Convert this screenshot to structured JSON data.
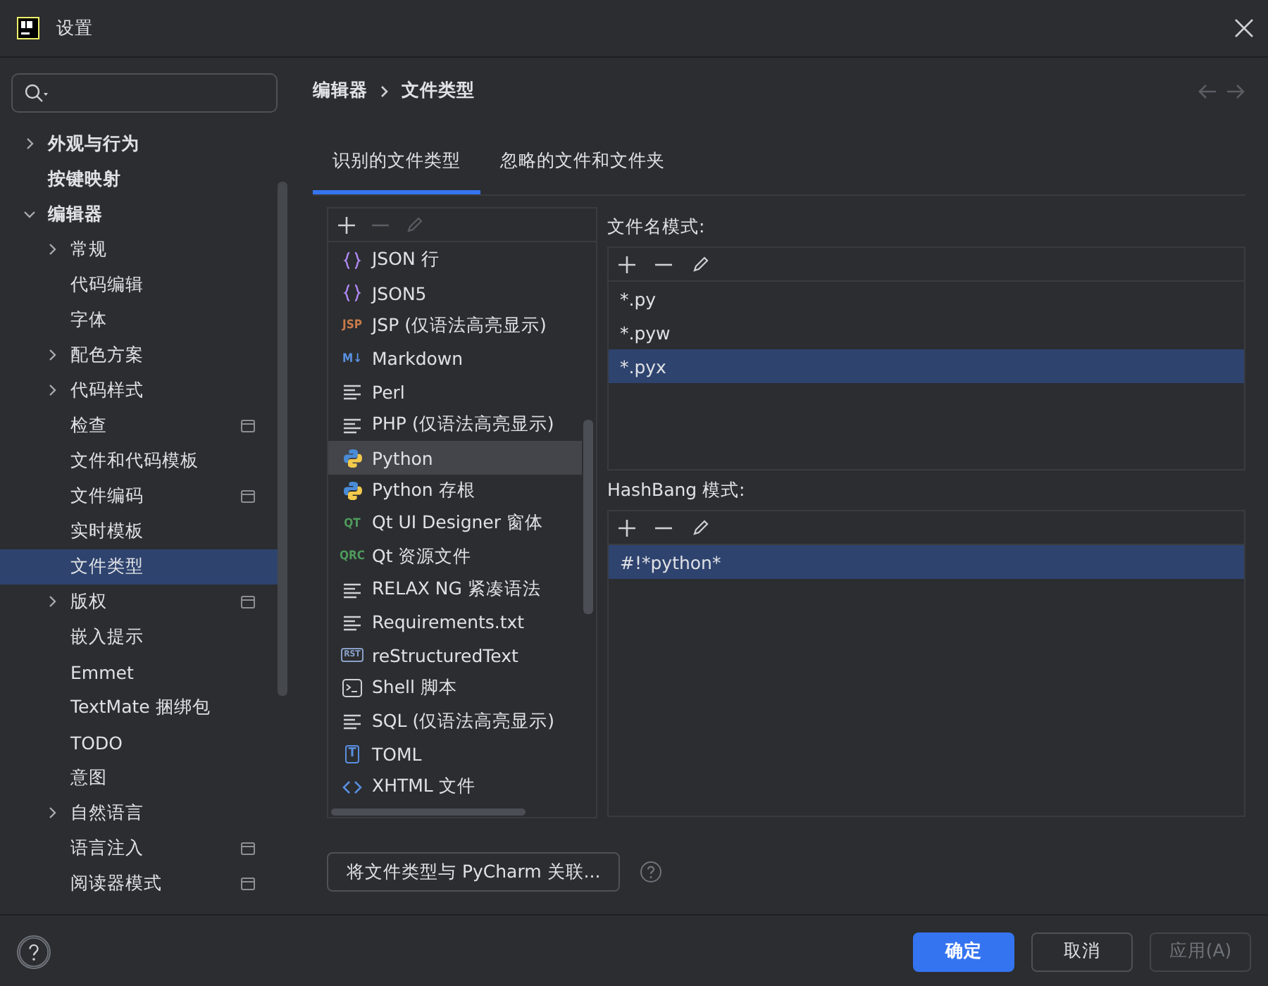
{
  "window": {
    "title": "设置"
  },
  "sidebar": {
    "items": [
      {
        "label": "外观与行为",
        "bold": true,
        "expanded": false,
        "selected": false,
        "project": false
      },
      {
        "label": "按键映射",
        "bold": true,
        "selected": false,
        "project": false
      },
      {
        "label": "编辑器",
        "bold": true,
        "expanded": true,
        "selected": false,
        "project": false,
        "children": [
          {
            "label": "常规",
            "expanded": false,
            "selected": false,
            "project": false
          },
          {
            "label": "代码编辑",
            "selected": false,
            "project": false
          },
          {
            "label": "字体",
            "selected": false,
            "project": false
          },
          {
            "label": "配色方案",
            "expanded": false,
            "selected": false,
            "project": false
          },
          {
            "label": "代码样式",
            "expanded": false,
            "selected": false,
            "project": false
          },
          {
            "label": "检查",
            "selected": false,
            "project": true
          },
          {
            "label": "文件和代码模板",
            "selected": false,
            "project": false
          },
          {
            "label": "文件编码",
            "selected": false,
            "project": true
          },
          {
            "label": "实时模板",
            "selected": false,
            "project": false
          },
          {
            "label": "文件类型",
            "selected": true,
            "project": false
          },
          {
            "label": "版权",
            "expanded": false,
            "selected": false,
            "project": true
          },
          {
            "label": "嵌入提示",
            "selected": false,
            "project": false
          },
          {
            "label": "Emmet",
            "selected": false,
            "project": false
          },
          {
            "label": "TextMate 捆绑包",
            "selected": false,
            "project": false
          },
          {
            "label": "TODO",
            "selected": false,
            "project": false
          },
          {
            "label": "意图",
            "selected": false,
            "project": false
          },
          {
            "label": "自然语言",
            "expanded": false,
            "selected": false,
            "project": false
          },
          {
            "label": "语言注入",
            "selected": false,
            "project": true
          },
          {
            "label": "阅读器模式",
            "selected": false,
            "project": true
          }
        ]
      }
    ]
  },
  "breadcrumb": [
    "编辑器",
    "文件类型"
  ],
  "tabs": [
    {
      "label": "识别的文件类型",
      "selected": true
    },
    {
      "label": "忽略的文件和文件夹",
      "selected": false
    }
  ],
  "file_types": {
    "toolbar": [
      {
        "kind": "add",
        "disabled": false
      },
      {
        "kind": "remove",
        "disabled": true
      },
      {
        "kind": "edit",
        "disabled": true
      }
    ],
    "items": [
      {
        "label": "JSON 行",
        "kind": "braces",
        "selected": false
      },
      {
        "label": "JSON5",
        "kind": "braces",
        "selected": false
      },
      {
        "label": "JSP (仅语法高亮显示)",
        "kind": "badge",
        "icon_text": "JSP",
        "color": "#c87a4a",
        "selected": false
      },
      {
        "label": "Markdown",
        "kind": "badge",
        "icon_text": "M↓",
        "color": "#5a8fe0",
        "selected": false
      },
      {
        "label": "Perl",
        "kind": "lines",
        "selected": false
      },
      {
        "label": "PHP (仅语法高亮显示)",
        "kind": "lines",
        "selected": false
      },
      {
        "label": "Python",
        "kind": "python",
        "selected": true
      },
      {
        "label": "Python 存根",
        "kind": "python",
        "selected": false
      },
      {
        "label": "Qt UI Designer 窗体",
        "kind": "badge",
        "icon_text": "QT",
        "color": "#4f9a5c",
        "selected": false
      },
      {
        "label": "Qt 资源文件",
        "kind": "badge",
        "icon_text": "QRC",
        "color": "#4f9a5c",
        "selected": false
      },
      {
        "label": "RELAX NG 紧凑语法",
        "kind": "lines",
        "selected": false
      },
      {
        "label": "Requirements.txt",
        "kind": "lines",
        "selected": false
      },
      {
        "label": "reStructuredText",
        "kind": "boxed",
        "icon_text": "RST",
        "color": "#8aa0c8",
        "selected": false
      },
      {
        "label": "Shell 脚本",
        "kind": "terminal",
        "selected": false
      },
      {
        "label": "SQL (仅语法高亮显示)",
        "kind": "lines",
        "selected": false
      },
      {
        "label": "TOML",
        "kind": "boxed",
        "icon_text": "T",
        "color": "#5a8fe0",
        "selected": false
      },
      {
        "label": "XHTML 文件",
        "kind": "tag",
        "selected": false
      }
    ]
  },
  "filename_patterns": {
    "title": "文件名模式:",
    "toolbar": [
      {
        "kind": "add",
        "disabled": false
      },
      {
        "kind": "remove",
        "disabled": false
      },
      {
        "kind": "edit",
        "disabled": false
      }
    ],
    "items": [
      {
        "label": "*.py",
        "selected": false
      },
      {
        "label": "*.pyw",
        "selected": false
      },
      {
        "label": "*.pyx",
        "selected": true
      }
    ]
  },
  "hashbang_patterns": {
    "title": "HashBang 模式:",
    "toolbar": [
      {
        "kind": "add",
        "disabled": false
      },
      {
        "kind": "remove",
        "disabled": false
      },
      {
        "kind": "edit",
        "disabled": false
      }
    ],
    "items": [
      {
        "label": "#!*python*",
        "selected": true
      }
    ]
  },
  "associate_button": "将文件类型与 PyCharm 关联...",
  "buttons": [
    {
      "label": "确定",
      "kind": "primary",
      "disabled": false
    },
    {
      "label": "取消",
      "kind": "normal",
      "disabled": false
    },
    {
      "label": "应用(A)",
      "kind": "normal",
      "disabled": true
    }
  ]
}
